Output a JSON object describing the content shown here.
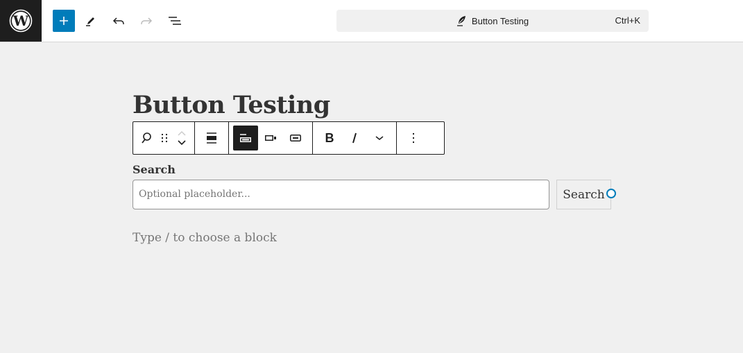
{
  "header": {
    "logo": "wordpress-logo",
    "toolbar": [
      {
        "name": "add-block",
        "icon": "plus-icon",
        "label": "Toggle block inserter"
      },
      {
        "name": "tools",
        "icon": "pencil-icon",
        "label": "Tools"
      },
      {
        "name": "undo",
        "icon": "undo-icon",
        "label": "Undo"
      },
      {
        "name": "redo",
        "icon": "redo-icon",
        "label": "Redo",
        "disabled": true
      },
      {
        "name": "document-overview",
        "icon": "list-view-icon",
        "label": "Document Overview"
      }
    ],
    "command_bar": {
      "icon": "post-icon",
      "title": "Button Testing",
      "shortcut": "Ctrl+K"
    }
  },
  "colors": {
    "accent": "#007cba",
    "dark": "#1e1e1e",
    "canvas": "#f0f0f0"
  },
  "editor": {
    "post_title": "Button Testing",
    "block_toolbar": {
      "groups": [
        [
          "block-type-search",
          "drag-handle",
          "move-up",
          "move-down"
        ],
        [
          "align"
        ],
        [
          "button-outside",
          "button-inside",
          "no-button"
        ],
        [
          "bold",
          "italic",
          "more-rich-text"
        ],
        [
          "options"
        ]
      ]
    },
    "search_block": {
      "label": "Search",
      "placeholder": "Optional placeholder...",
      "button_text": "Search"
    },
    "appender_text": "Type / to choose a block"
  }
}
